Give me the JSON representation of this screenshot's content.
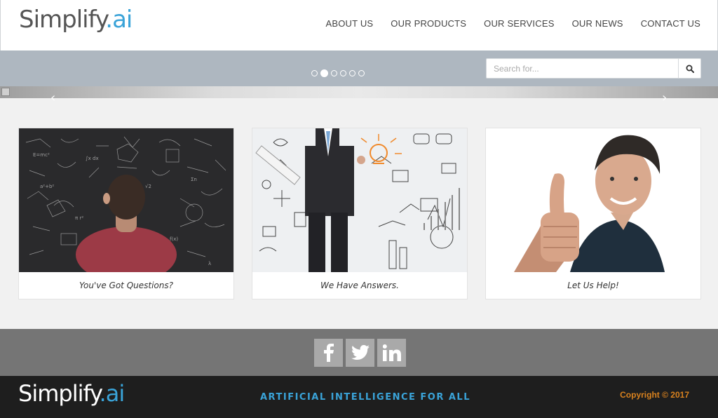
{
  "brand": {
    "name_main": "Simplify",
    "name_accent": ".ai",
    "accent_color": "#3aa3d8"
  },
  "nav": {
    "items": [
      "ABOUT US",
      "OUR PRODUCTS",
      "OUR SERVICES",
      "OUR NEWS",
      "CONTACT US"
    ]
  },
  "slider": {
    "dot_count": 6,
    "active_dot": 1,
    "search_placeholder": "Search for...",
    "search_icon": "magnifier-icon",
    "prev_arrow": "‹",
    "next_arrow": "›"
  },
  "cards": [
    {
      "caption": "You've Got Questions?",
      "image": "man-at-chalkboard-photo"
    },
    {
      "caption": "We Have Answers.",
      "image": "businessman-with-sketches-photo"
    },
    {
      "caption": "Let Us Help!",
      "image": "thumbs-up-man-photo"
    }
  ],
  "social": {
    "icons": [
      "facebook-icon",
      "twitter-icon",
      "linkedin-icon"
    ]
  },
  "footer": {
    "tagline": "ARTIFICIAL INTELLIGENCE FOR ALL",
    "copyright": "Copyright © 2017",
    "copyright_color": "#d9821e"
  }
}
